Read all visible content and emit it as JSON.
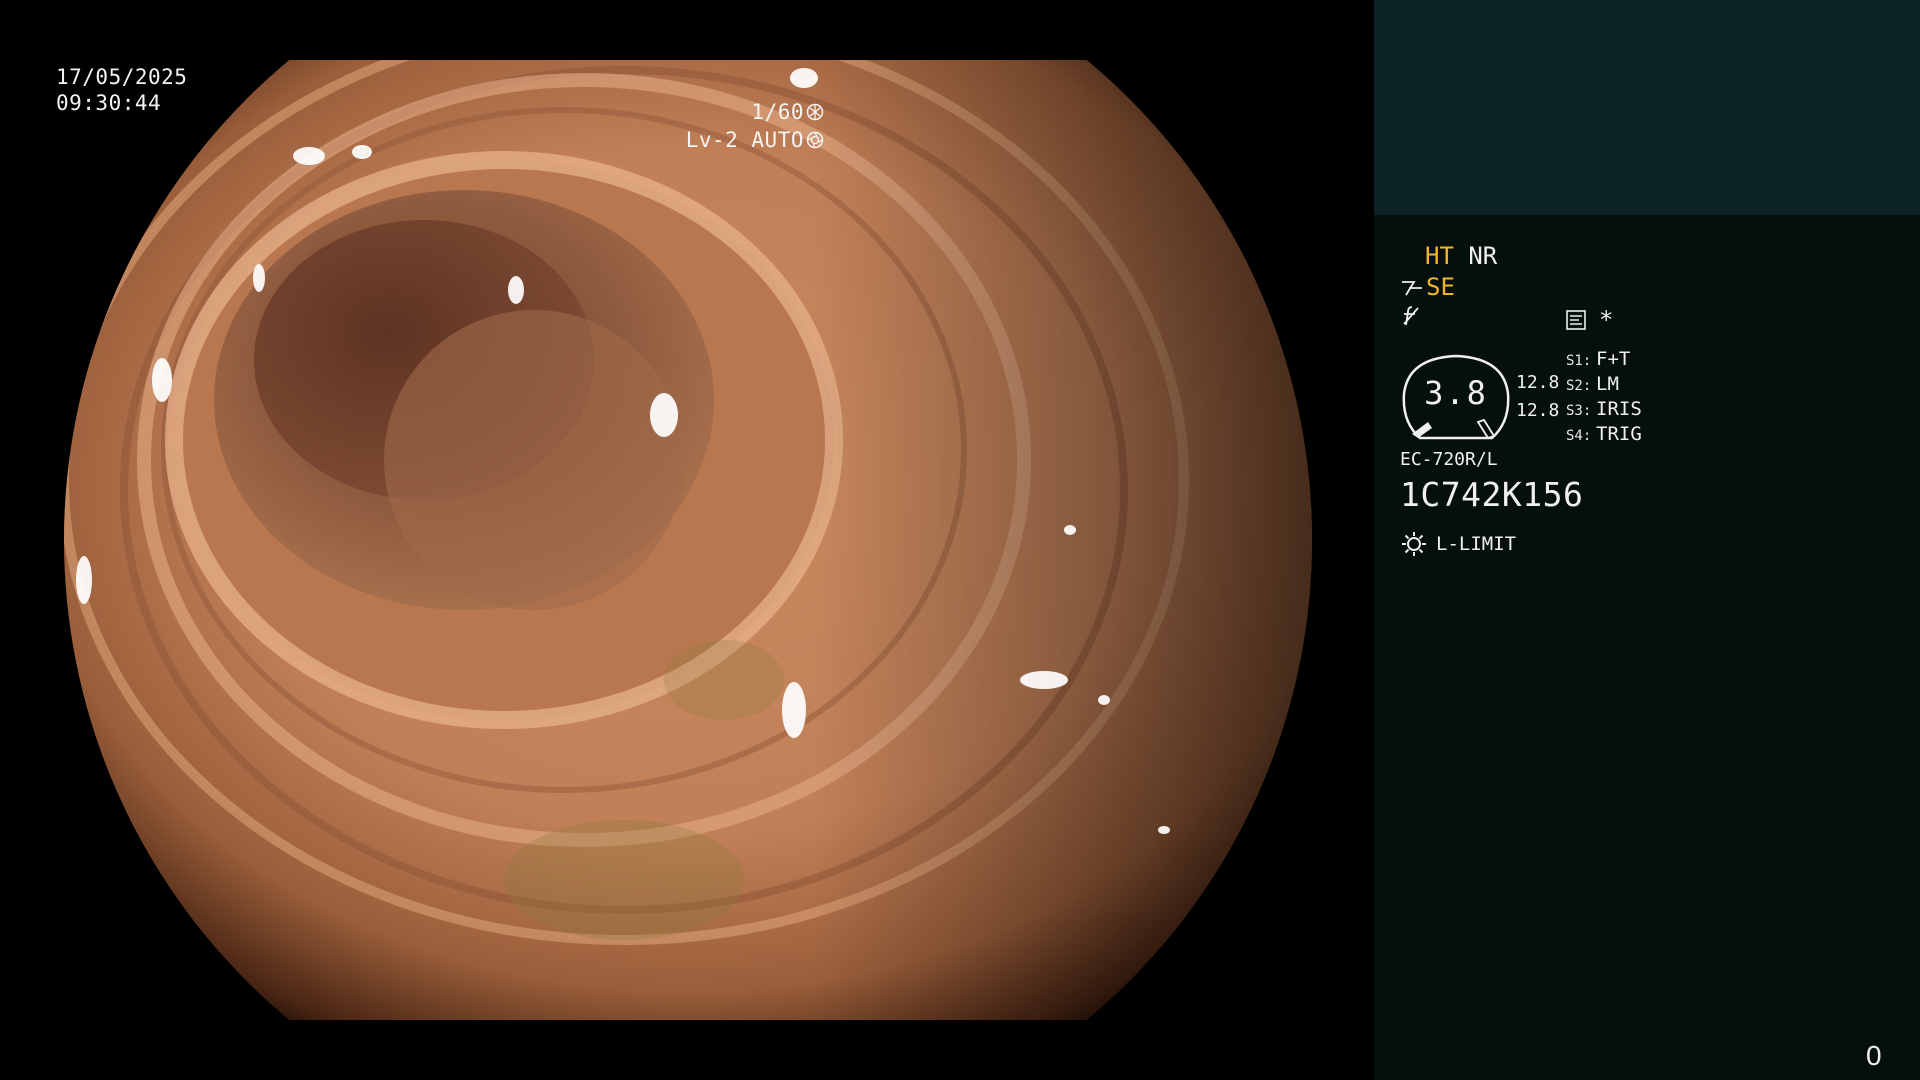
{
  "view": {
    "date": "17/05/2025",
    "time": "09:30:44",
    "shutter": "1/60",
    "shutter_icon": "aperture-icon",
    "iris_mode": "Lv-2 AUTO",
    "iris_icon": "iris-icon"
  },
  "panel": {
    "ht_label": "HT",
    "nr_label": "NR",
    "se_label": "SE",
    "se_icon": "enhance-icon",
    "f_icon": "struck-f-icon",
    "doc_icon": "memo-icon",
    "asterisk": "*",
    "zoom_value": "3.8",
    "value_1": "12.8",
    "value_2": "12.8",
    "switches": [
      {
        "key": "S1:",
        "value": "F+T"
      },
      {
        "key": "S2:",
        "value": "LM"
      },
      {
        "key": "S3:",
        "value": "IRIS"
      },
      {
        "key": "S4:",
        "value": "TRIG"
      }
    ],
    "model": "EC-720R/L",
    "serial": "1C742K156",
    "light_icon": "lamp-icon",
    "light_mode": "L-LIMIT",
    "counter": "0"
  },
  "colors": {
    "amber": "#f5b52a",
    "panel_top": "#0c2426",
    "panel_bottom": "#040f0e"
  }
}
